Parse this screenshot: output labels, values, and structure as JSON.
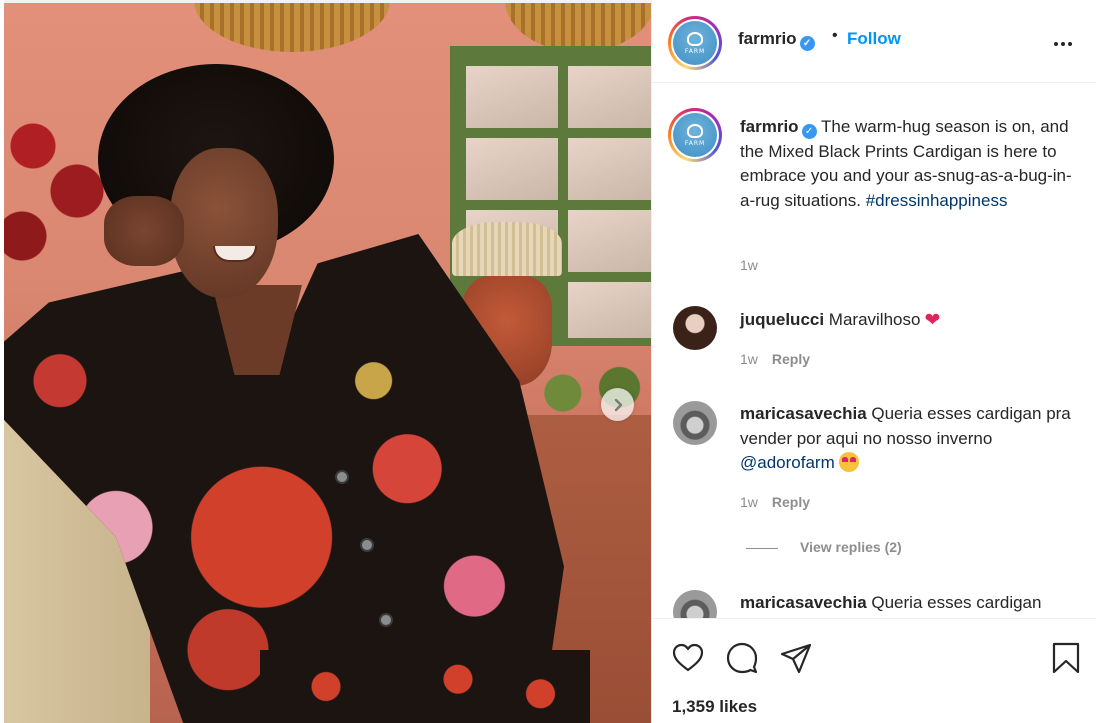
{
  "post": {
    "username": "farmrio",
    "verified_mark": "✓",
    "separator": "•",
    "follow_label": "Follow",
    "logo_text": "FARM",
    "caption_part1": " The warm-hug season is on, and the Mixed Black Prints Cardigan is here to embrace you and your as-snug-as-a-bug-in-a-rug situations. ",
    "caption_hashtag": "#dressinhappiness",
    "caption_time": "1w",
    "likes": "1,359 likes"
  },
  "comments": [
    {
      "username": "juquelucci",
      "text": " Maravilhoso",
      "emoji": "heart",
      "time": "1w",
      "reply_label": "Reply"
    },
    {
      "username": "maricasavechia",
      "text": " Queria esses cardigan pra vender por aqui no nosso inverno ",
      "mention": "@adorofarm",
      "emoji": "heart-eyes-face",
      "time": "1w",
      "reply_label": "Reply"
    },
    {
      "username": "maricasavechia",
      "text": " Queria esses cardigan"
    }
  ],
  "view_replies_label": "View replies (2)",
  "icons": {
    "like": "heart-icon",
    "comment": "comment-icon",
    "share": "share-icon",
    "save": "bookmark-icon",
    "more": "more-options-icon",
    "next": "chevron-right-icon"
  },
  "colors": {
    "follow": "#0095f6",
    "hashtag": "#00376b",
    "muted": "#8e8e8e",
    "verified": "#3897f0"
  }
}
